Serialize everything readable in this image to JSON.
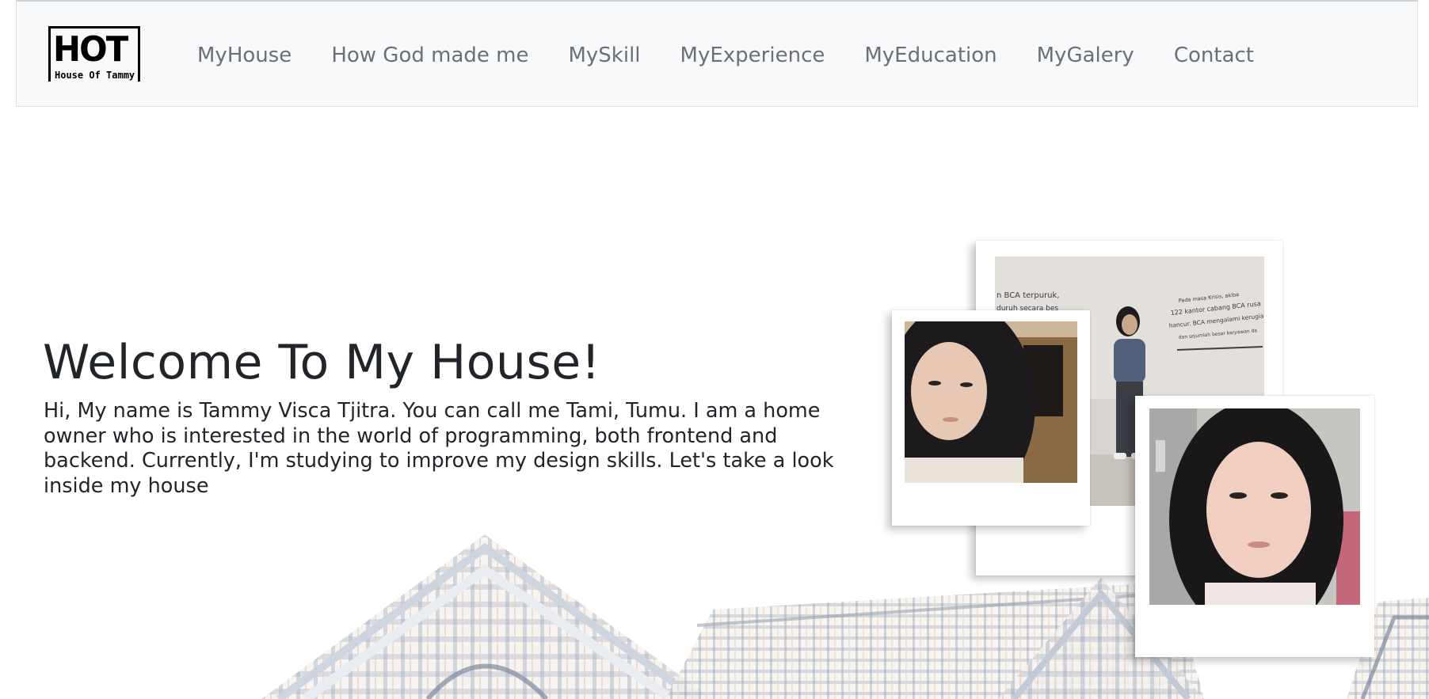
{
  "logo": {
    "title": "HOT",
    "subtitle": "House Of Tammy"
  },
  "nav": {
    "items": [
      {
        "label": "MyHouse"
      },
      {
        "label": "How God made me"
      },
      {
        "label": "MySkill"
      },
      {
        "label": "MyExperience"
      },
      {
        "label": "MyEducation"
      },
      {
        "label": "MyGalery"
      },
      {
        "label": "Contact"
      }
    ]
  },
  "hero": {
    "title": "Welcome To My House!",
    "text": "Hi, My name is Tammy Visca Tjitra. You can call me Tami, Tumu. I am a home owner who is interested in the world of programming, both frontend and backend. Currently, I'm studying to improve my design skills. Let's take a look inside my house"
  },
  "gallery": {
    "photo_back_caption": {
      "line1": "n BCA terpuruk,",
      "line2": "duruh secara bes",
      "line3": "Pada masa Krisis, akiba",
      "line4": "122 kantor cabang BCA rusa",
      "line5": "hancur. BCA mengalami kerugia",
      "line6": "dan sejumlah besar karyawan da"
    }
  },
  "colors": {
    "navbar_bg": "#f8f9fa",
    "nav_text": "#6c6f73",
    "heading_text": "#212529",
    "house_sketch": "#8a95a8"
  }
}
